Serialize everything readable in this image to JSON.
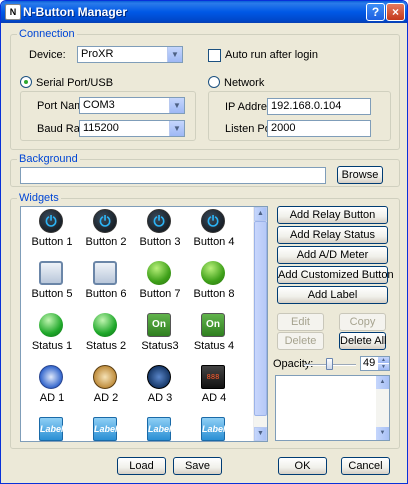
{
  "window": {
    "title": "N-Button Manager",
    "icon_text": "N",
    "help_label": "?",
    "close_label": "×"
  },
  "connection": {
    "group_label": "Connection",
    "device_label": "Device:",
    "device_value": "ProXR",
    "autorun_label": "Auto run after login",
    "autorun_checked": false,
    "serial_label": "Serial Port/USB",
    "serial_selected": true,
    "network_label": "Network",
    "network_selected": false,
    "port_name_label": "Port Name:",
    "port_name_value": "COM3",
    "baud_rate_label": "Baud Rate:",
    "baud_rate_value": "115200",
    "ip_label": "IP Address:",
    "ip_value": "192.168.0.104",
    "listen_port_label": "Listen Port:",
    "listen_port_value": "2000"
  },
  "background": {
    "group_label": "Background",
    "path_value": "",
    "browse_label": "Browse"
  },
  "widgets": {
    "group_label": "Widgets",
    "items": [
      {
        "label": "Button 1",
        "icon": "power-button-icon",
        "glyph": "⏻"
      },
      {
        "label": "Button 2",
        "icon": "power-button-icon",
        "glyph": "⏻"
      },
      {
        "label": "Button 3",
        "icon": "power-button-icon",
        "glyph": "⏻"
      },
      {
        "label": "Button 4",
        "icon": "power-button-icon",
        "glyph": "⏻"
      },
      {
        "label": "Button 5",
        "icon": "square-button-icon",
        "glyph": ""
      },
      {
        "label": "Button 6",
        "icon": "square-button-icon",
        "glyph": ""
      },
      {
        "label": "Button 7",
        "icon": "green-ball-button-icon",
        "glyph": ""
      },
      {
        "label": "Button 8",
        "icon": "green-ball-button-icon",
        "glyph": ""
      },
      {
        "label": "Status 1",
        "icon": "green-led-icon",
        "glyph": ""
      },
      {
        "label": "Status 2",
        "icon": "green-led-icon",
        "glyph": ""
      },
      {
        "label": "Status3",
        "icon": "on-switch-icon",
        "glyph": "On"
      },
      {
        "label": "Status 4",
        "icon": "on-switch-icon",
        "glyph": "On"
      },
      {
        "label": "AD 1",
        "icon": "blue-gauge-icon",
        "glyph": ""
      },
      {
        "label": "AD 2",
        "icon": "brass-gauge-icon",
        "glyph": ""
      },
      {
        "label": "AD 3",
        "icon": "dark-gauge-icon",
        "glyph": ""
      },
      {
        "label": "AD 4",
        "icon": "digital-display-icon",
        "glyph": "888"
      },
      {
        "label": "",
        "icon": "label-widget-icon",
        "glyph": "Label"
      },
      {
        "label": "",
        "icon": "label-widget-icon",
        "glyph": "Label"
      },
      {
        "label": "",
        "icon": "label-widget-icon",
        "glyph": "Label"
      },
      {
        "label": "",
        "icon": "label-widget-icon",
        "glyph": "Label"
      }
    ],
    "add_relay_button_label": "Add Relay Button",
    "add_relay_status_label": "Add Relay Status",
    "add_ad_meter_label": "Add A/D Meter",
    "add_custom_button_label": "Add Customized Button",
    "add_label_label": "Add Label",
    "edit_label": "Edit",
    "copy_label": "Copy",
    "delete_label": "Delete",
    "delete_all_label": "Delete All",
    "opacity_label": "Opacity:",
    "opacity_value": "49"
  },
  "footer": {
    "load_label": "Load",
    "save_label": "Save",
    "ok_label": "OK",
    "cancel_label": "Cancel"
  }
}
